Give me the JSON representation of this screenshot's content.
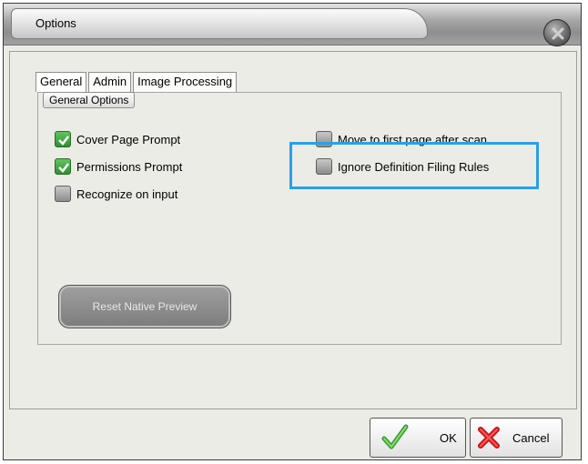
{
  "window": {
    "title": "Options"
  },
  "tabs": [
    {
      "label": "General",
      "active": true
    },
    {
      "label": "Admin",
      "active": false
    },
    {
      "label": "Image Processing",
      "active": false
    }
  ],
  "general_options": {
    "group_label": "General Options",
    "cover_page_prompt": {
      "label": "Cover Page Prompt",
      "checked": true
    },
    "permissions_prompt": {
      "label": "Permissions Prompt",
      "checked": true
    },
    "recognize_on_input": {
      "label": "Recognize on input",
      "checked": false
    },
    "move_to_first_page": {
      "label": "Move to first page after scan",
      "checked": false
    },
    "ignore_definition_filing_rules": {
      "label": "Ignore Definition Filing Rules",
      "checked": false
    },
    "reset_native_preview_label": "Reset Native Preview"
  },
  "footer": {
    "ok_label": "OK",
    "cancel_label": "Cancel"
  },
  "colors": {
    "highlight": "#2aa0e6",
    "checkbox_checked": "#3fa83f"
  },
  "icons": {
    "close": "close-icon",
    "ok": "checkmark-icon",
    "cancel": "red-x-icon"
  }
}
